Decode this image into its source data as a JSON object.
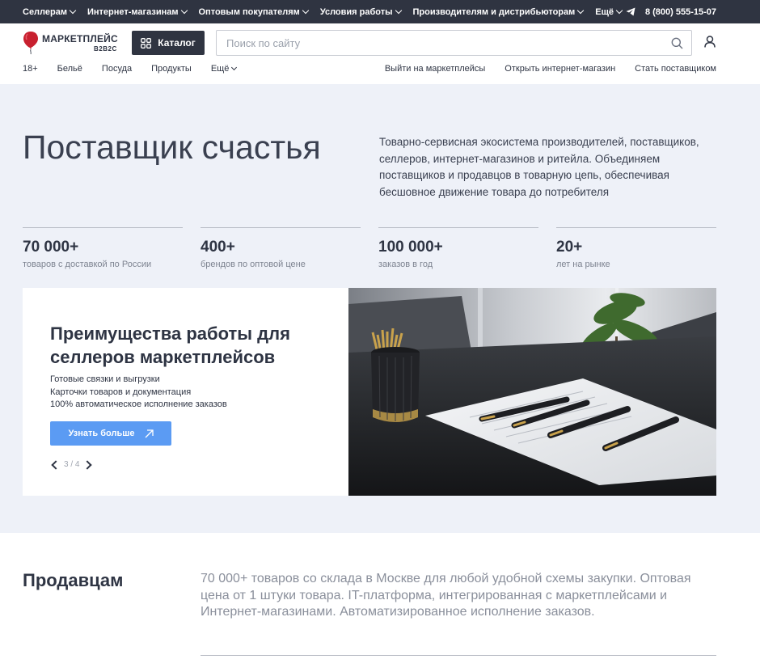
{
  "topbar": {
    "menu": [
      {
        "label": "Селлерам"
      },
      {
        "label": "Интернет-магазинам"
      },
      {
        "label": "Оптовым покупателям"
      },
      {
        "label": "Условия работы"
      },
      {
        "label": "Производителям и дистрибьюторам"
      },
      {
        "label": "Ещё"
      }
    ],
    "phone": "8 (800) 555-15-07",
    "phone_icon": "telegram-icon"
  },
  "header": {
    "logo_name": "МАРКЕТПЛЕЙС",
    "logo_sub": "B2B2C",
    "catalog_label": "Каталог",
    "search_placeholder": "Поиск по сайту",
    "search_value": ""
  },
  "subnav": {
    "left": [
      {
        "label": "18+"
      },
      {
        "label": "Бельё"
      },
      {
        "label": "Посуда"
      },
      {
        "label": "Продукты"
      },
      {
        "label": "Ещё"
      }
    ],
    "right": [
      {
        "label": "Выйти на маркетплейсы"
      },
      {
        "label": "Открыть интернет-магазин"
      },
      {
        "label": "Стать поставщиком"
      }
    ]
  },
  "hero": {
    "title": "Поставщик счастья",
    "description": "Товарно-сервисная экосистема производителей, поставщиков, селлеров, интернет-магазинов и ритейла. Объединяем поставщиков и продавцов в товарную цепь, обеспечивая бесшовное движение товара до потребителя",
    "stats": [
      {
        "value": "70 000+",
        "label": "товаров с доставкой по России"
      },
      {
        "value": "400+",
        "label": "брендов по оптовой цене"
      },
      {
        "value": "100 000+",
        "label": "заказов в год"
      },
      {
        "value": "20+",
        "label": "лет на рынке"
      }
    ]
  },
  "slide": {
    "title": "Преимущества работы для селлеров маркетплейсов",
    "points": [
      "Готовые связки и выгрузки",
      "Карточки товаров и документация",
      "100% автоматическое исполнение заказов"
    ],
    "button_label": "Узнать больше",
    "pager": "3 / 4"
  },
  "sellers": {
    "title": "Продавцам",
    "text": "70 000+ товаров со склада в Москве для любой удобной схемы закупки. Оптовая цена от 1 штуки товара. IT-платформа, интегрированная с маркетплейсами и Интернет-магазинами. Автоматизированное исполнение заказов."
  },
  "colors": {
    "dark": "#2f3441",
    "accent_blue": "#5b9bf3",
    "hero_bg": "#eef1f8",
    "logo_red": "#c8202f"
  }
}
